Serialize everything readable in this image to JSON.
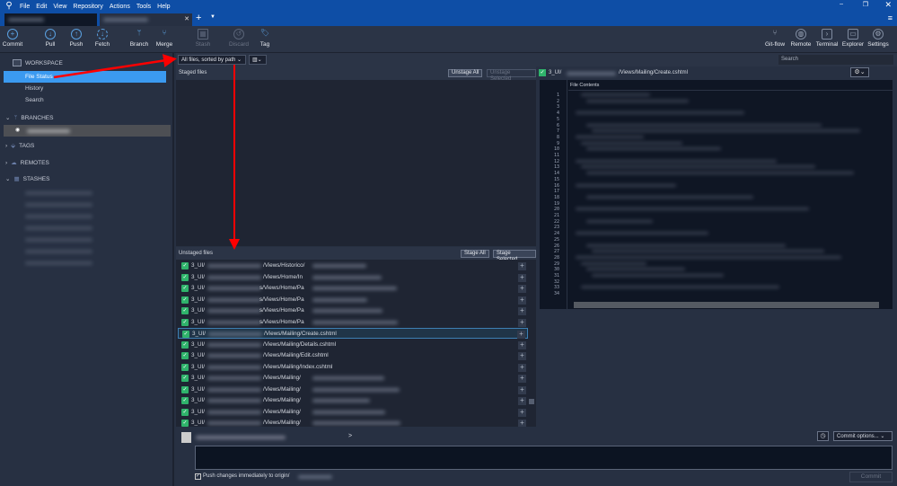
{
  "menu": [
    "File",
    "Edit",
    "View",
    "Repository",
    "Actions",
    "Tools",
    "Help"
  ],
  "toolbar": {
    "left": [
      "Commit",
      "Pull",
      "Push",
      "Fetch",
      "Branch",
      "Merge",
      "Stash",
      "Discard",
      "Tag"
    ],
    "right": [
      "Git-flow",
      "Remote",
      "Terminal",
      "Explorer",
      "Settings"
    ]
  },
  "sidebar": {
    "workspace": "WORKSPACE",
    "items": [
      "File Status",
      "History",
      "Search"
    ],
    "branches": "BRANCHES",
    "tags": "TAGS",
    "remotes": "REMOTES",
    "stashes": "STASHES"
  },
  "filter": {
    "sort": "All files, sorted by path"
  },
  "search": {
    "placeholder": "Search"
  },
  "staged": {
    "title": "Staged files",
    "unstage_all": "Unstage All",
    "unstage_selected": "Unstage Selected"
  },
  "unstaged": {
    "title": "Unstaged files",
    "stage_all": "Stage All",
    "stage_selected": "Stage Selected",
    "files": [
      {
        "prefix": "3_UI/",
        "path": "/Views/Historico/"
      },
      {
        "prefix": "3_UI/",
        "path": "/Views/Home/In"
      },
      {
        "prefix": "3_UI/",
        "path": "s/Views/Home/Pa"
      },
      {
        "prefix": "3_UI/",
        "path": "s/Views/Home/Pa"
      },
      {
        "prefix": "3_UI/",
        "path": "s/Views/Home/Pa"
      },
      {
        "prefix": "3_UI/",
        "path": "s/Views/Home/Pa"
      },
      {
        "prefix": "3_UI/",
        "path": "/Views/Mailing/Create.cshtml",
        "selected": true
      },
      {
        "prefix": "3_UI/",
        "path": "/Views/Mailing/Details.cshtml"
      },
      {
        "prefix": "3_UI/",
        "path": "/Views/Mailing/Edit.cshtml"
      },
      {
        "prefix": "3_UI/",
        "path": "/Views/Mailing/Index.cshtml"
      },
      {
        "prefix": "3_UI/",
        "path": "/Views/Mailing/"
      },
      {
        "prefix": "3_UI/",
        "path": "/Views/Mailing/"
      },
      {
        "prefix": "3_UI/",
        "path": "/Views/Mailing/"
      },
      {
        "prefix": "3_UI/",
        "path": "/Views/Mailing/"
      },
      {
        "prefix": "3_UI/",
        "path": "/Views/Mailing/"
      }
    ]
  },
  "diff": {
    "prefix": "3_UI/",
    "path": "/Views/Mailing/Create.cshtml",
    "header": "File Contents",
    "line_count": 34
  },
  "commit": {
    "email_suffix": ">",
    "options": "Commit options...",
    "push_label": "Push changes immediately to origin/",
    "button": "Commit"
  }
}
